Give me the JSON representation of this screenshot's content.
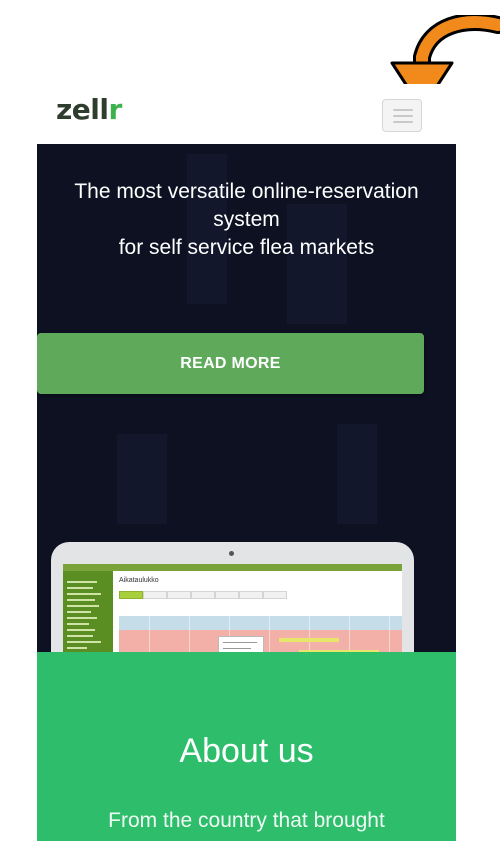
{
  "navbar": {
    "logo": {
      "prefix": "zell",
      "accent": "r"
    },
    "menu_toggle_icon": "hamburger-menu-icon"
  },
  "annotation": {
    "arrow_icon": "curved-arrow-icon",
    "arrow_color": "#f28a1b"
  },
  "hero": {
    "title_lines": [
      "The most versatile online-reservation",
      "system",
      "for self service flea markets"
    ],
    "read_more_label": "READ MORE"
  },
  "laptop": {
    "screen_title": "Aikataulukko"
  },
  "about": {
    "title": "About us",
    "text": "From the country that brought"
  },
  "colors": {
    "brand_green": "#3bb24d",
    "hero_background": "#0d1122",
    "button_green": "#5fa95a",
    "about_green": "#2ebe6b"
  }
}
